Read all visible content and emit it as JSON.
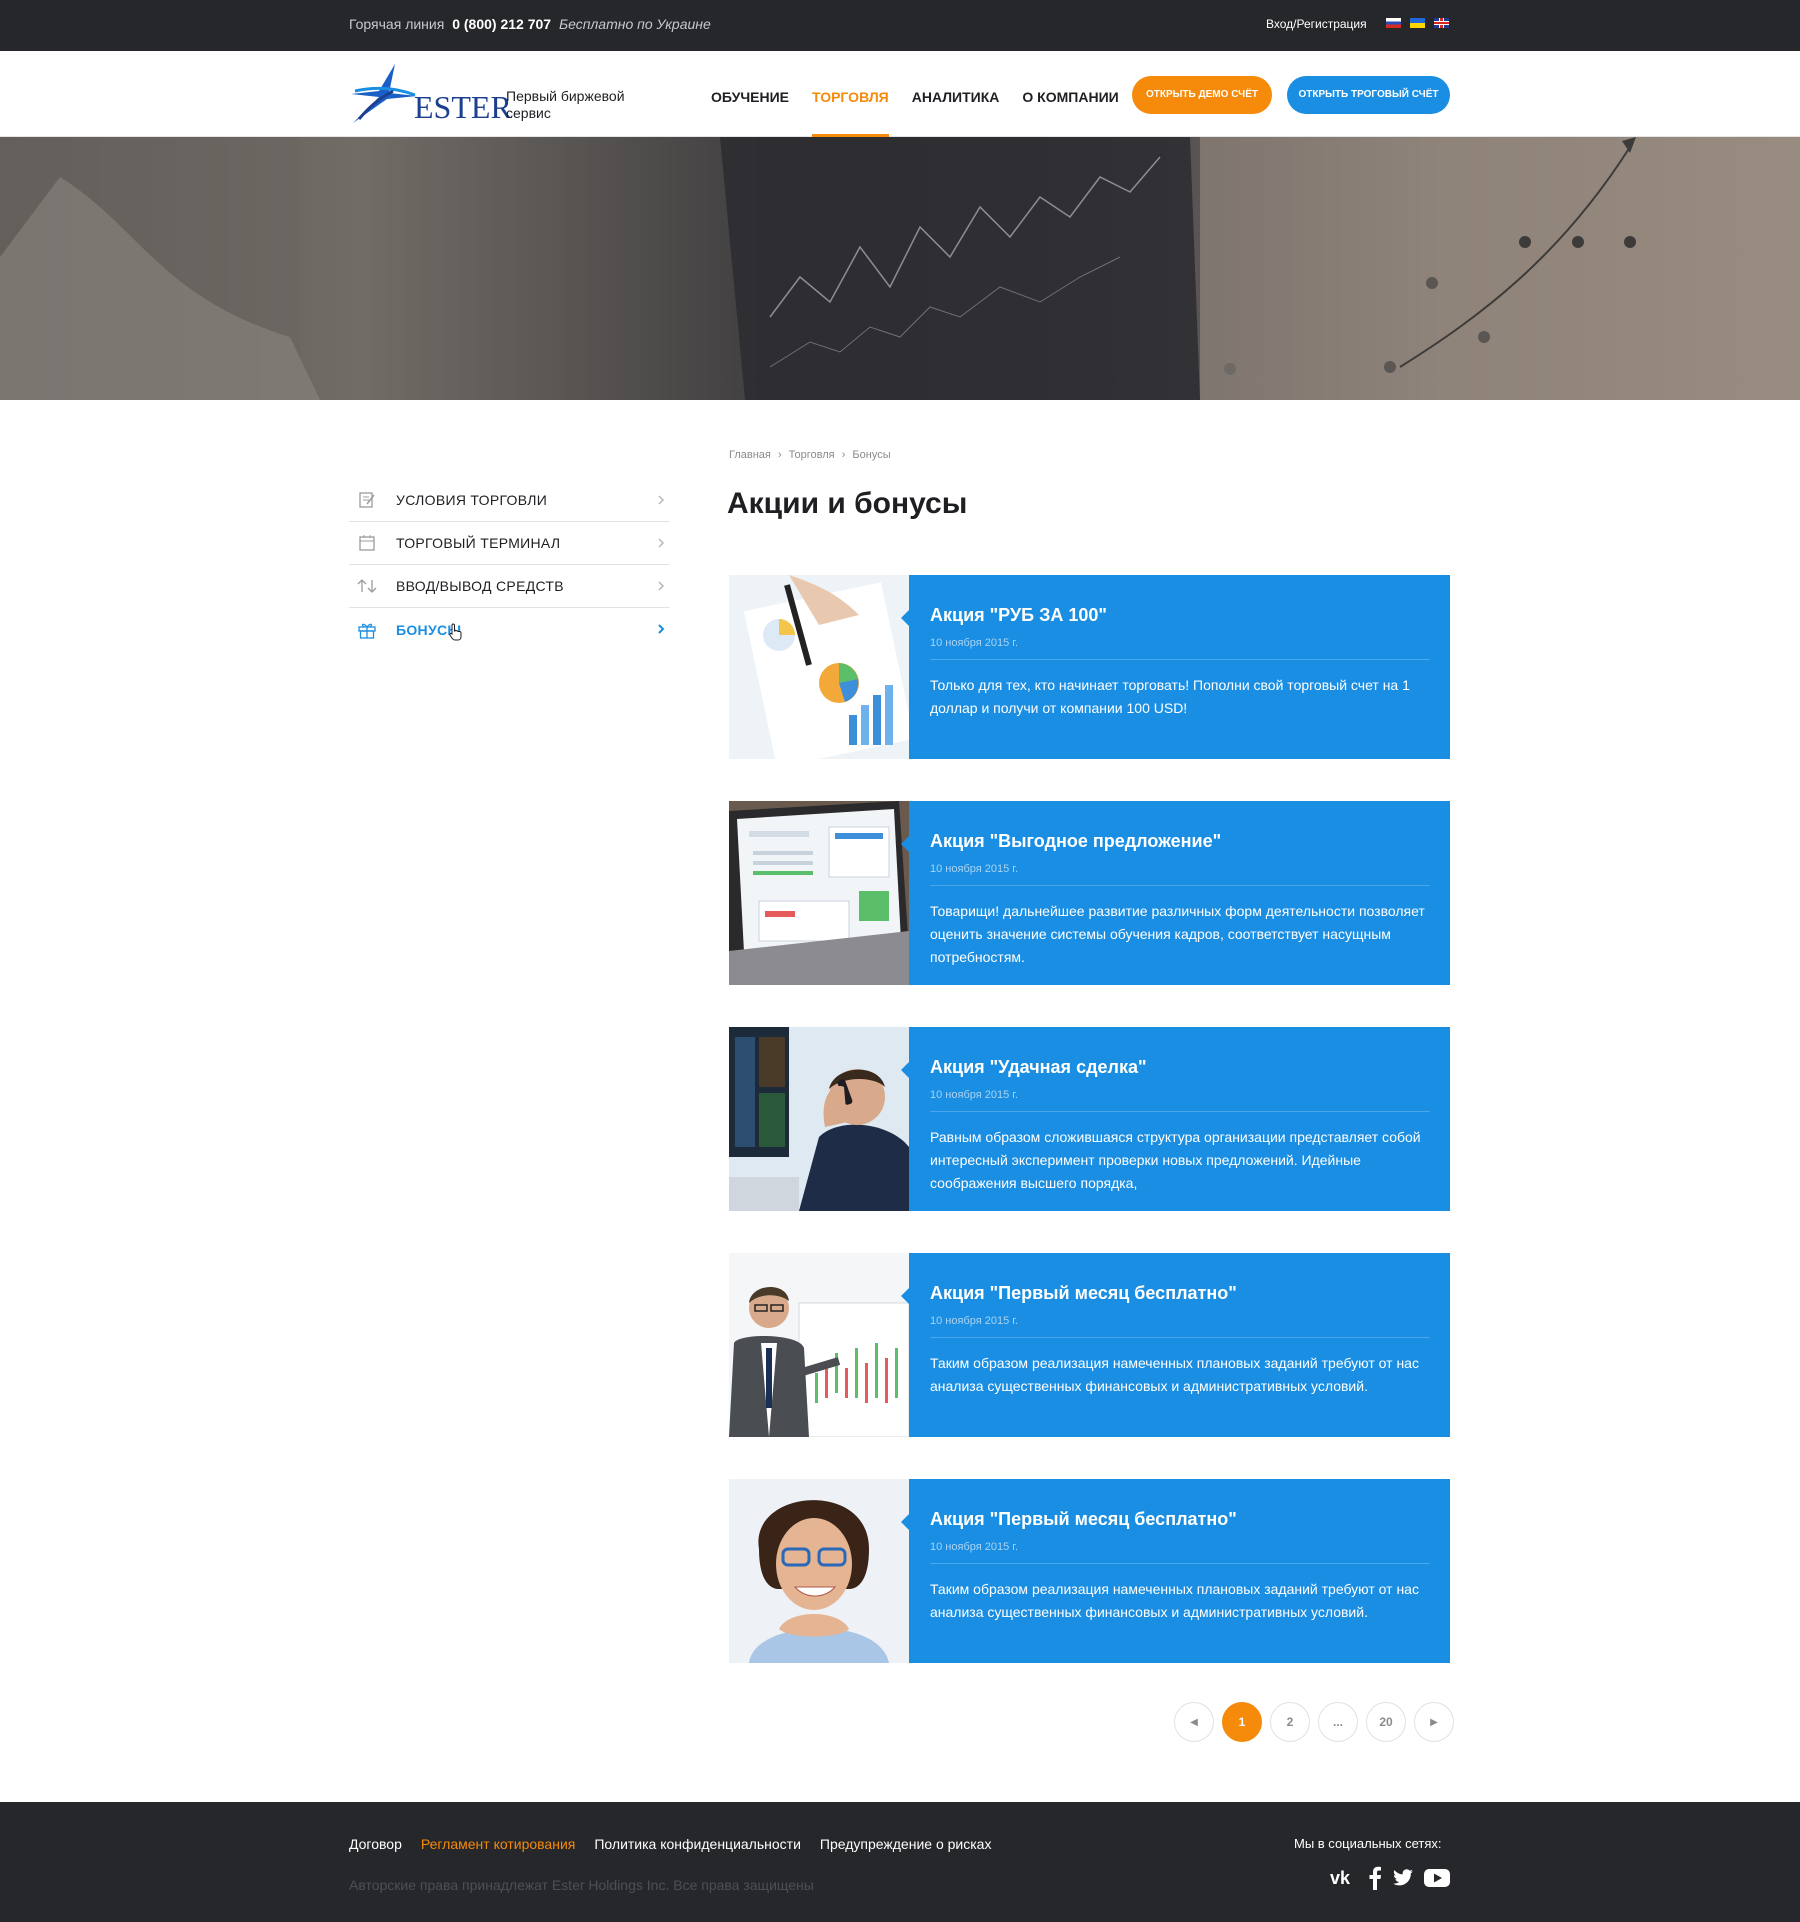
{
  "topbar": {
    "hotline_label": "Горячая линия",
    "hotline_number": "0 (800) 212 707",
    "hotline_note": "Бесплатно по Украине",
    "auth": "Вход/Регистрация"
  },
  "header": {
    "logo_text": "ESTER",
    "tagline": "Первый биржевой сервис",
    "nav": [
      "ОБУЧЕНИЕ",
      "ТОРГОВЛЯ",
      "АНАЛИТИКА",
      "О КОМПАНИИ"
    ],
    "active_nav": "ТОРГОВЛЯ",
    "btn_demo": "ОТКРЫТЬ ДЕМО СЧЁТ",
    "btn_trade": "ОТКРЫТЬ ТРОГОВЫЙ СЧЁТ"
  },
  "sidebar": {
    "items": [
      {
        "label": "УСЛОВИЯ ТОРГОВЛИ",
        "icon": "document-icon"
      },
      {
        "label": "ТОРГОВЫЙ ТЕРМИНАЛ",
        "icon": "terminal-icon"
      },
      {
        "label": "ВВОД/ВЫВОД СРЕДСТВ",
        "icon": "transfer-arrows-icon"
      },
      {
        "label": "БОНУСЫ",
        "icon": "gift-icon"
      }
    ],
    "active": "БОНУСЫ"
  },
  "breadcrumb": [
    "Главная",
    "›",
    "Торговля",
    "›",
    "Бонусы"
  ],
  "page_title": "Акции и бонусы",
  "promos": [
    {
      "title": "Акция \"РУБ ЗА 100\"",
      "date": "10 ноября 2015 г.",
      "text": "Только для тех, кто начинает торговать! Пополни свой торговый счет на 1 доллар и получи от компании 100 USD!"
    },
    {
      "title": "Акция \"Выгодное предложение\"",
      "date": "10 ноября 2015 г.",
      "text": "Товарищи! дальнейшее развитие различных форм деятельности позволяет оценить значение системы обучения кадров, соответствует насущным потребностям."
    },
    {
      "title": "Акция \"Удачная сделка\"",
      "date": "10 ноября 2015 г.",
      "text": "Равным образом сложившаяся структура организации представляет собой интересный эксперимент проверки новых предложений. Идейные соображения высшего порядка,"
    },
    {
      "title": "Акция \"Первый месяц бесплатно\"",
      "date": "10 ноября 2015 г.",
      "text": "Таким образом реализация намеченных плановых заданий требуют от нас анализа существенных финансовых и административных условий."
    },
    {
      "title": "Акция \"Первый месяц бесплатно\"",
      "date": "10 ноября 2015 г.",
      "text": "Таким образом реализация намеченных плановых заданий требуют от нас анализа существенных финансовых и административных условий."
    }
  ],
  "pagination": {
    "prev": "◀",
    "pages": [
      "1",
      "2",
      "...",
      "20"
    ],
    "current": "1",
    "next": "▶"
  },
  "footer": {
    "links": [
      "Договор",
      "Регламент котирования",
      "Политика конфиденциальности",
      "Предупреждение о рисках"
    ],
    "highlighted_link": "Регламент котирования",
    "copyright": "Авторские права принадлежат  Ester Holdings Inc. Все права защищены",
    "social_label": "Мы в социальных сетях:",
    "socials": [
      "vk-icon",
      "facebook-icon",
      "twitter-icon",
      "youtube-icon"
    ]
  },
  "colors": {
    "accent_orange": "#f58a0b",
    "accent_blue": "#1a8ee2",
    "dark": "#26272b"
  }
}
